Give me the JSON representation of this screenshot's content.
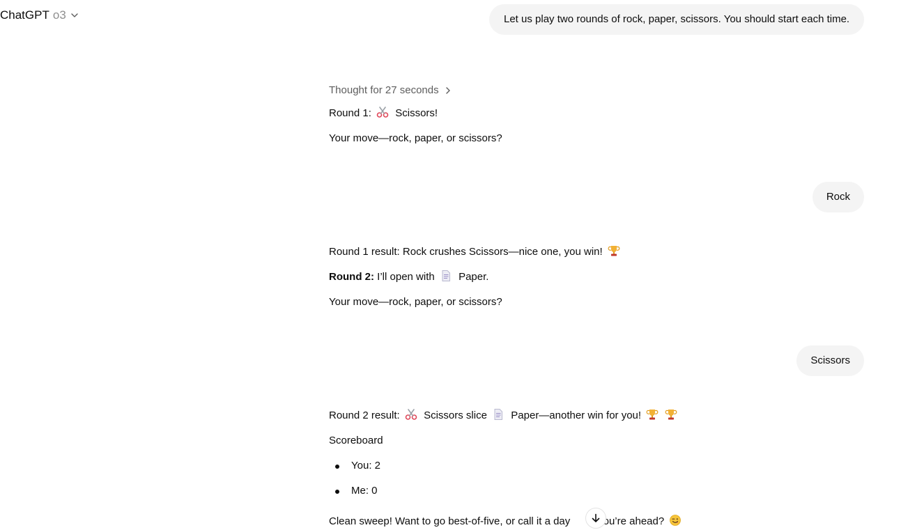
{
  "header": {
    "brand": "ChatGPT",
    "model": "o3",
    "dropdown_icon": "chevron-down-icon"
  },
  "messages": {
    "user_1": "Let us play two rounds of rock, paper, scissors. You should start each time.",
    "thought": "Thought for 27 seconds",
    "assistant_1": {
      "round_label": "Round 1:",
      "round_move": "Scissors!",
      "prompt": "Your move—rock, paper, or scissors?"
    },
    "user_2": "Rock",
    "assistant_2": {
      "result": "Round 1 result: Rock crushes Scissors—nice one, you win!",
      "round2_label": "Round 2:",
      "round2_text": "I’ll open with",
      "round2_move": "Paper.",
      "prompt": "Your move—rock, paper, or scissors?"
    },
    "user_3": "Scissors",
    "assistant_3": {
      "result_prefix": "Round 2 result:",
      "result_move": "Scissors slice",
      "result_rest": "Paper—another win for you!",
      "scoreboard_title": "Scoreboard",
      "scoreboard": [
        "You: 2",
        "Me: 0"
      ],
      "closing_start": "Clean sweep! Want to go best-of-five, or call it a day",
      "closing_end": "le you’re ahead?"
    }
  },
  "icons": {
    "scissors": "scissors-icon",
    "trophy": "trophy-icon",
    "paper": "page-icon",
    "wink": "winking-face-icon",
    "scroll": "arrow-down-icon"
  },
  "colors": {
    "bubble": "#f4f4f4",
    "muted_text": "#5d5d5d",
    "model_text": "#8f8f8f"
  }
}
